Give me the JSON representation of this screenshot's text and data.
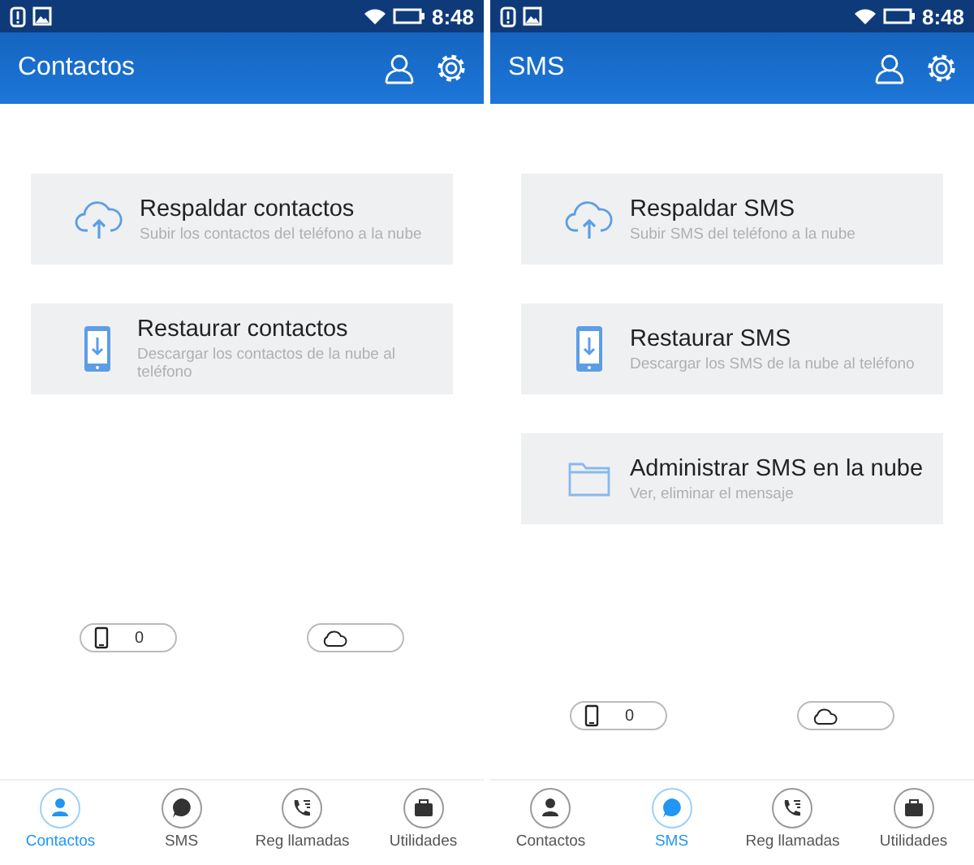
{
  "screens": [
    {
      "status_bar": {
        "time": "8:48"
      },
      "app_bar": {
        "title": "Contactos"
      },
      "actions": [
        {
          "kind": "cloud-upload",
          "title": "Respaldar contactos",
          "subtitle": "Subir los contactos del teléfono a la nube"
        },
        {
          "kind": "phone-download",
          "title": "Restaurar contactos",
          "subtitle": "Descargar los contactos de la nube al teléfono"
        }
      ],
      "counters": [
        {
          "kind": "phone",
          "value": "0"
        },
        {
          "kind": "cloud"
        }
      ],
      "tabs": [
        {
          "kind": "person",
          "label": "Contactos",
          "selected": true
        },
        {
          "kind": "chat",
          "label": "SMS",
          "selected": false
        },
        {
          "kind": "call",
          "label": "Reg llamadas",
          "selected": false
        },
        {
          "kind": "briefcase",
          "label": "Utilidades",
          "selected": false
        }
      ]
    },
    {
      "status_bar": {
        "time": "8:48"
      },
      "app_bar": {
        "title": "SMS"
      },
      "actions": [
        {
          "kind": "cloud-upload",
          "title": "Respaldar SMS",
          "subtitle": "Subir SMS del teléfono a la nube"
        },
        {
          "kind": "phone-download",
          "title": "Restaurar SMS",
          "subtitle": "Descargar los SMS de la nube al teléfono"
        },
        {
          "kind": "folder",
          "title": "Administrar SMS en la nube",
          "subtitle": "Ver, eliminar el mensaje"
        }
      ],
      "counters": [
        {
          "kind": "phone",
          "value": "0"
        },
        {
          "kind": "cloud"
        }
      ],
      "tabs": [
        {
          "kind": "person",
          "label": "Contactos",
          "selected": false
        },
        {
          "kind": "chat",
          "label": "SMS",
          "selected": true
        },
        {
          "kind": "call",
          "label": "Reg llamadas",
          "selected": false
        },
        {
          "kind": "briefcase",
          "label": "Utilidades",
          "selected": false
        }
      ]
    }
  ]
}
